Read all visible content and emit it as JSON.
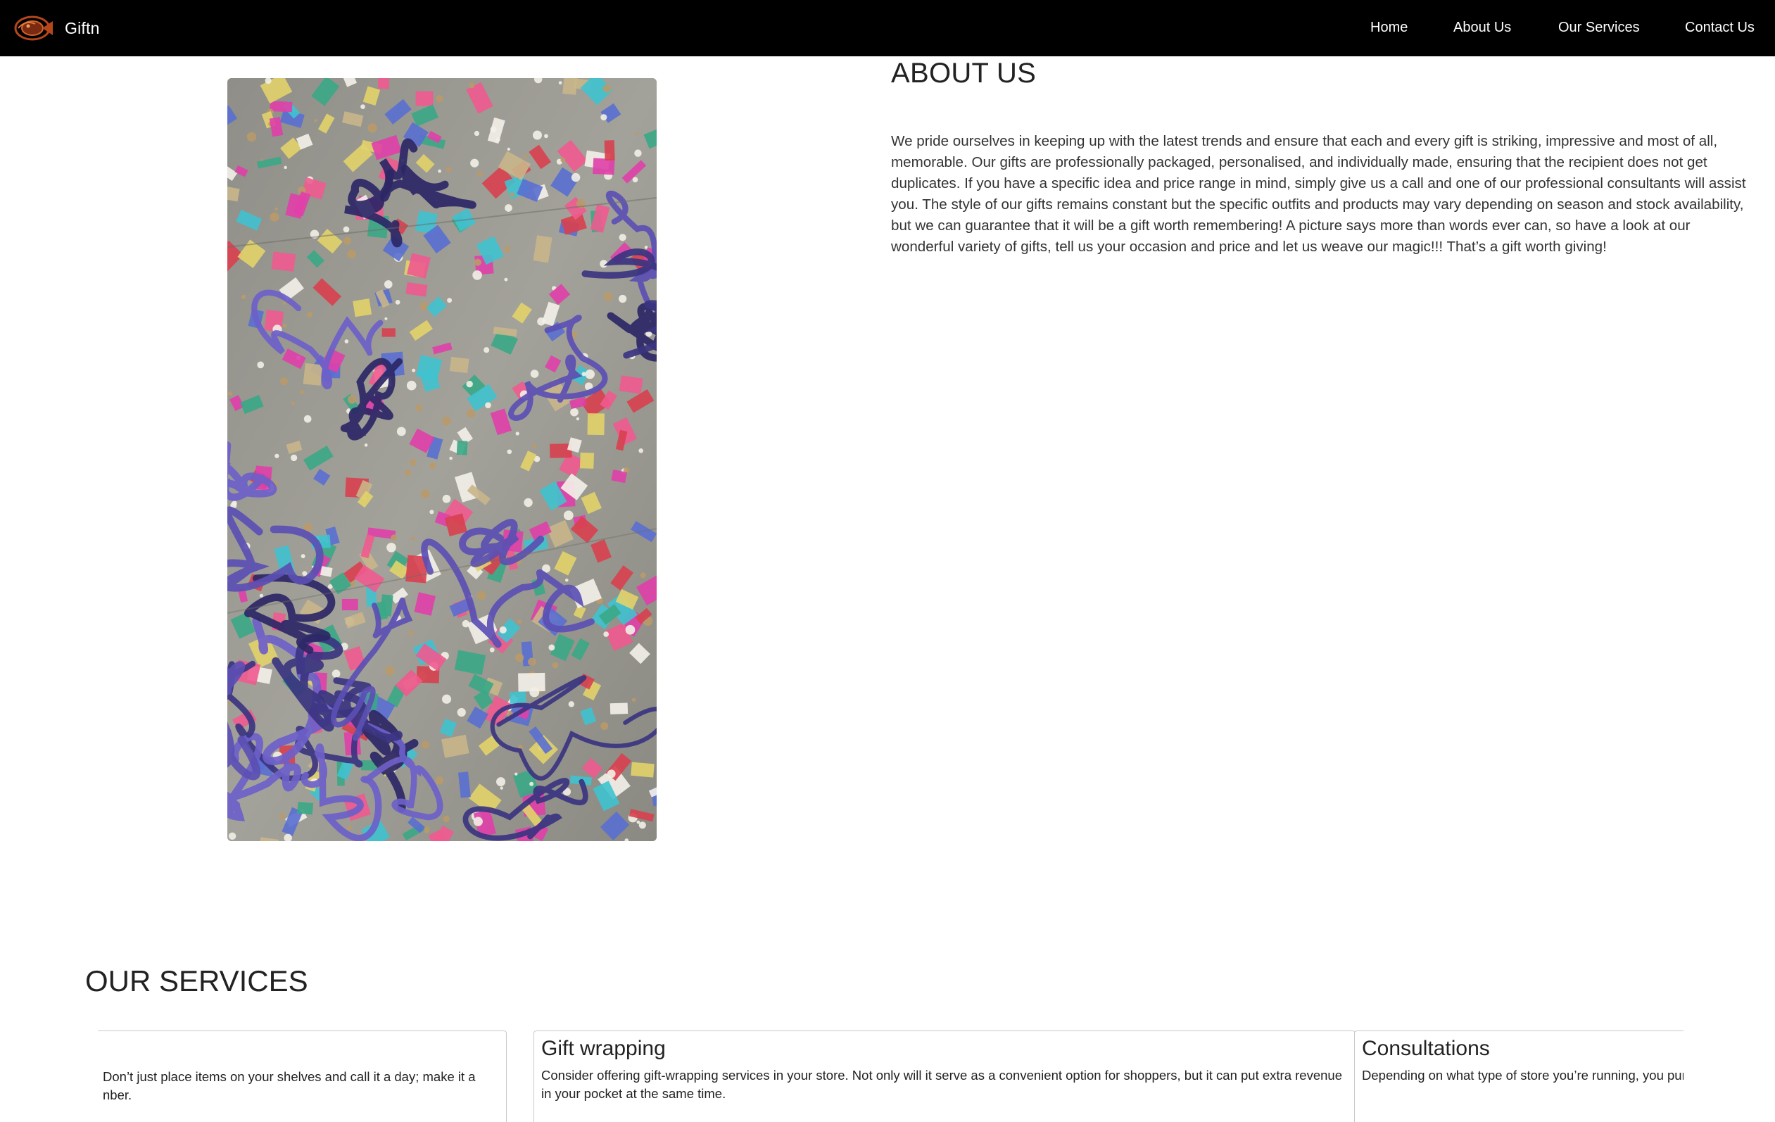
{
  "navbar": {
    "brand": "Giftn",
    "logo_icon": "fish-logo-icon",
    "links": [
      {
        "label": "Home"
      },
      {
        "label": "About Us"
      },
      {
        "label": "Our Services"
      },
      {
        "label": "Contact Us"
      }
    ]
  },
  "about": {
    "title": "ABOUT US",
    "image": "confetti-streamers-photo",
    "text": "We pride ourselves in keeping up with the latest trends and ensure that each and every gift is striking, impressive and most of all, memorable. Our gifts are professionally packaged, personalised, and individually made, ensuring that the recipient does not get duplicates. If you have a specific idea and price range in mind, simply give us a call and one of our professional consultants will assist you. The style of our gifts remains constant but the specific outfits and products may vary depending on season and stock availability, but we can guarantee that it will be a gift worth remembering! A picture says more than words ever can, so have a look at our wonderful variety of gifts, tell us your occasion and price and let us weave our magic!!! That’s a gift worth giving!"
  },
  "services": {
    "title": "OUR SERVICES",
    "cards": [
      {
        "title": "",
        "text": "Don’t just place items on your shelves and call it a day; make it a nber."
      },
      {
        "title": "Gift wrapping",
        "text": "Consider offering gift-wrapping services in your store. Not only will it serve as a convenient option for shoppers, but it can put extra revenue in your pocket at the same time."
      },
      {
        "title": "Consultations",
        "text": "Depending on what type of store you’re running, you purchases. Depending on what type of store you’re r"
      }
    ]
  },
  "colors": {
    "navbar_bg": "#000000",
    "page_bg": "#ffffff",
    "logo_accent": "#c0531f"
  }
}
